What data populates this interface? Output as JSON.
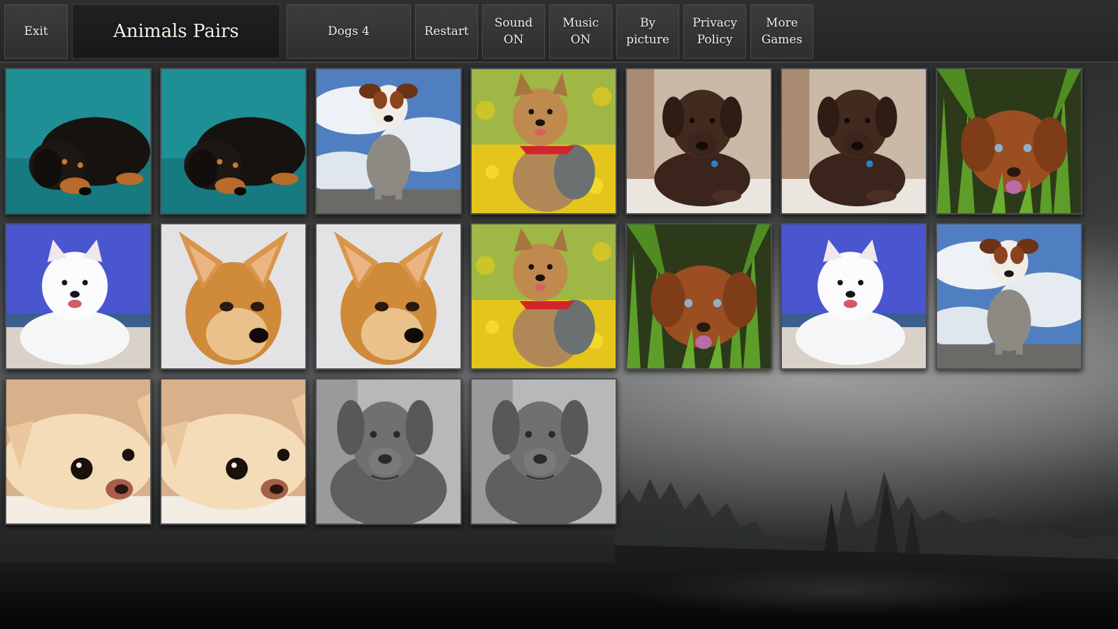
{
  "toolbar": {
    "exit_label": "Exit",
    "title": "Animals Pairs",
    "set_label": "Dogs 4",
    "restart_label": "Restart",
    "sound_label": "Sound\nON",
    "music_label": "Music\nON",
    "by_picture_label": "By\npicture",
    "privacy_label": "Privacy\nPolicy",
    "more_games_label": "More\nGames"
  },
  "board": {
    "columns": 7,
    "cards": [
      {
        "dog": "dachshund-icon"
      },
      {
        "dog": "dachshund-icon"
      },
      {
        "dog": "terrier-sky-icon"
      },
      {
        "dog": "yorkie-icon"
      },
      {
        "dog": "labrador-icon"
      },
      {
        "dog": "labrador-icon"
      },
      {
        "dog": "retriever-grass-icon"
      },
      {
        "dog": "samoyed-icon"
      },
      {
        "dog": "chihuahua-icon"
      },
      {
        "dog": "chihuahua-icon"
      },
      {
        "dog": "yorkie-icon"
      },
      {
        "dog": "retriever-grass-icon"
      },
      {
        "dog": "samoyed-icon"
      },
      {
        "dog": "terrier-sky-icon"
      },
      {
        "dog": "chihuahua-lying-icon"
      },
      {
        "dog": "chihuahua-lying-icon"
      },
      {
        "dog": "weimaraner-icon"
      },
      {
        "dog": "weimaraner-icon"
      }
    ]
  }
}
